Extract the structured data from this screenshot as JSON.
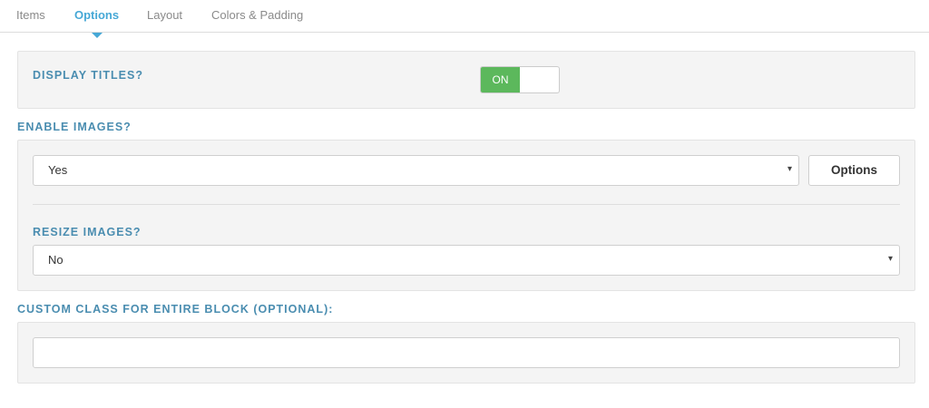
{
  "tabs": [
    {
      "label": "Items",
      "active": false
    },
    {
      "label": "Options",
      "active": true
    },
    {
      "label": "Layout",
      "active": false
    },
    {
      "label": "Colors & Padding",
      "active": false
    }
  ],
  "display_titles": {
    "label": "DISPLAY TITLES?",
    "toggle_state": "ON"
  },
  "enable_images": {
    "label": "ENABLE IMAGES?",
    "selected": "Yes",
    "options_button": "Options"
  },
  "resize_images": {
    "label": "RESIZE IMAGES?",
    "selected": "No"
  },
  "custom_class": {
    "label": "CUSTOM CLASS FOR ENTIRE BLOCK (OPTIONAL):",
    "value": ""
  },
  "colors": {
    "accent": "#46a8d6",
    "label": "#4a8db0",
    "toggle_on": "#5cb85c"
  }
}
